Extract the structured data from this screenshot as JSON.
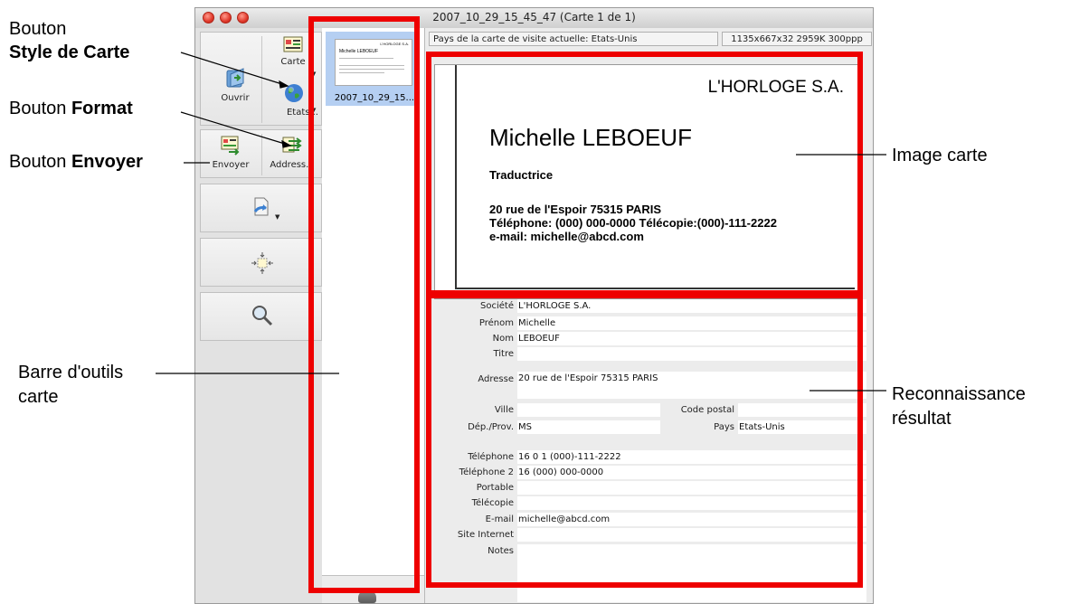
{
  "window": {
    "title": "2007_10_29_15_45_47 (Carte 1 de 1)"
  },
  "annotations": {
    "bouton_style_line1": "Bouton",
    "bouton_style_line2": "Style de Carte",
    "bouton_format_prefix": "Bouton ",
    "bouton_format_bold": "Format",
    "bouton_envoyer_prefix": "Bouton ",
    "bouton_envoyer_bold": "Envoyer",
    "barre_line1": "Barre d'outils",
    "barre_line2": "carte",
    "image_carte": "Image carte",
    "recon_line1": "Reconnaissance",
    "recon_line2": "résultat"
  },
  "toolbar": {
    "ouvrir": "Ouvrir",
    "carte": "Carte",
    "etats": "Etats...",
    "envoyer": "Envoyer",
    "address": "Address..."
  },
  "thumbnails": [
    {
      "name": "2007_10_29_15..."
    }
  ],
  "infobar": {
    "country": "Pays de la carte de visite actuelle: Etats-Unis",
    "image_info": "1135x667x32  2959K  300ppp"
  },
  "card": {
    "company": "L'HORLOGE S.A.",
    "name": "Michelle LEBOEUF",
    "job": "Traductrice",
    "address": "20 rue de l'Espoir 75315 PARIS",
    "phone": "Téléphone: (000) 000-0000    Télécopie:(000)-111-2222",
    "email": "e-mail: michelle@abcd.com",
    "mini_company": "L'HORLOGE S.A.",
    "mini_name": "Michelle LEBOEUF"
  },
  "form": {
    "societe_label": "Société",
    "societe_value": "L'HORLOGE S.A.",
    "prenom_label": "Prénom",
    "prenom_value": "Michelle",
    "nom_label": "Nom",
    "nom_value": "LEBOEUF",
    "titre_label": "Titre",
    "titre_value": "",
    "adresse_label": "Adresse",
    "adresse_value": "20 rue de l'Espoir 75315 PARIS",
    "ville_label": "Ville",
    "ville_value": "",
    "code_postal_label": "Code postal",
    "code_postal_value": "",
    "dep_label": "Dép./Prov.",
    "dep_value": "MS",
    "pays_label": "Pays",
    "pays_value": "Etats-Unis",
    "telephone_label": "Téléphone",
    "telephone_value": "16 0 1 (000)-111-2222",
    "telephone2_label": "Téléphone 2",
    "telephone2_value": "16 (000) 000-0000",
    "portable_label": "Portable",
    "portable_value": "",
    "telecopie_label": "Télécopie",
    "telecopie_value": "",
    "email_label": "E-mail",
    "email_value": "michelle@abcd.com",
    "site_label": "Site Internet",
    "site_value": "",
    "notes_label": "Notes",
    "notes_value": ""
  },
  "colors": {
    "highlight_red": "#ee0000",
    "selection_blue": "#b5cff2"
  }
}
